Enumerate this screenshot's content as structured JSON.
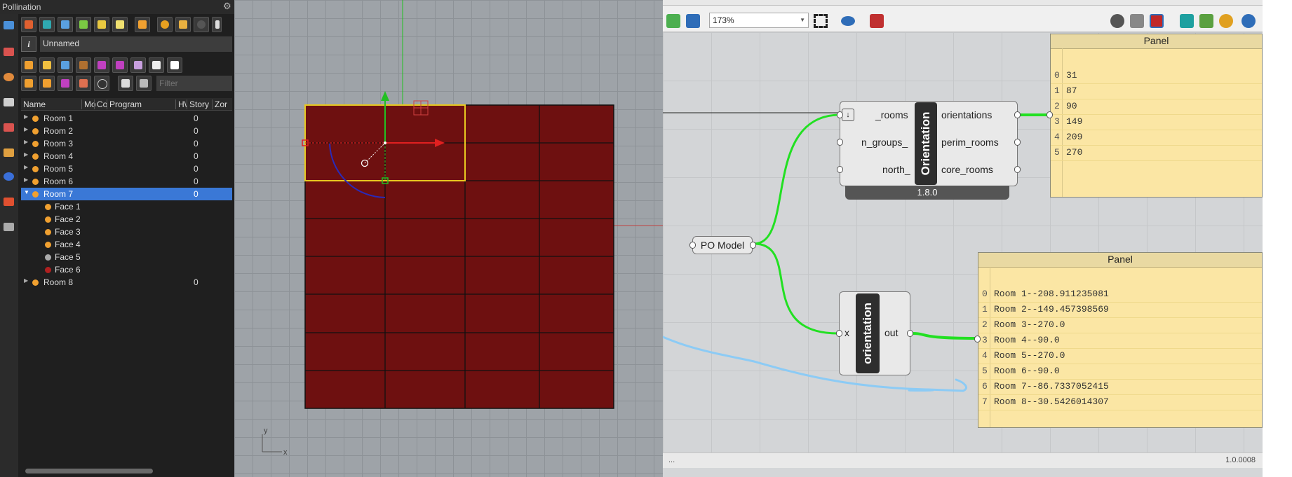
{
  "pollination": {
    "title": "Pollination",
    "model_name": "Unnamed",
    "filter_placeholder": "Filter",
    "columns": [
      "Name",
      "Mo",
      "Co",
      "Program",
      "H\\",
      "Story",
      "Zor"
    ],
    "rooms": [
      {
        "label": "Room 1",
        "value": "0"
      },
      {
        "label": "Room 2",
        "value": "0"
      },
      {
        "label": "Room 3",
        "value": "0"
      },
      {
        "label": "Room 4",
        "value": "0"
      },
      {
        "label": "Room 5",
        "value": "0"
      },
      {
        "label": "Room 6",
        "value": "0"
      },
      {
        "label": "Room 7",
        "value": "0"
      }
    ],
    "faces": [
      "Face 1",
      "Face 2",
      "Face 3",
      "Face 4",
      "Face 5",
      "Face 6"
    ],
    "room8": {
      "label": "Room 8",
      "value": "0"
    }
  },
  "viewport": {
    "axis_y": "y",
    "axis_x": "x"
  },
  "grasshopper": {
    "zoom": "173%",
    "status_left": "...",
    "status_right": "1.0.0008",
    "orientation_component": {
      "name": "Orientation",
      "inputs": [
        "_rooms",
        "n_groups_",
        "north_"
      ],
      "outputs": [
        "orientations",
        "perim_rooms",
        "core_rooms"
      ],
      "version": "1.8.0"
    },
    "po_model_label": "PO Model",
    "script_component": {
      "name": "orientation",
      "input": "x",
      "output": "out"
    },
    "panel_top": {
      "title": "Panel",
      "rows": [
        {
          "index": "0",
          "value": "31"
        },
        {
          "index": "1",
          "value": "87"
        },
        {
          "index": "2",
          "value": "90"
        },
        {
          "index": "3",
          "value": "149"
        },
        {
          "index": "4",
          "value": "209"
        },
        {
          "index": "5",
          "value": "270"
        }
      ]
    },
    "panel_bottom": {
      "title": "Panel",
      "rows": [
        {
          "index": "0",
          "value": "Room 1--208.911235081"
        },
        {
          "index": "1",
          "value": "Room 2--149.457398569"
        },
        {
          "index": "2",
          "value": "Room 3--270.0"
        },
        {
          "index": "3",
          "value": "Room 4--90.0"
        },
        {
          "index": "4",
          "value": "Room 5--270.0"
        },
        {
          "index": "5",
          "value": "Room 6--90.0"
        },
        {
          "index": "6",
          "value": "Room 7--86.7337052415"
        },
        {
          "index": "7",
          "value": "Room 8--30.5426014307"
        }
      ]
    }
  },
  "colors": {
    "room_fill": "#6e1010",
    "selection": "#3a78d6",
    "wire": "#22e022",
    "annotation": "#8ccbf5",
    "panel": "#fbe6a4"
  }
}
